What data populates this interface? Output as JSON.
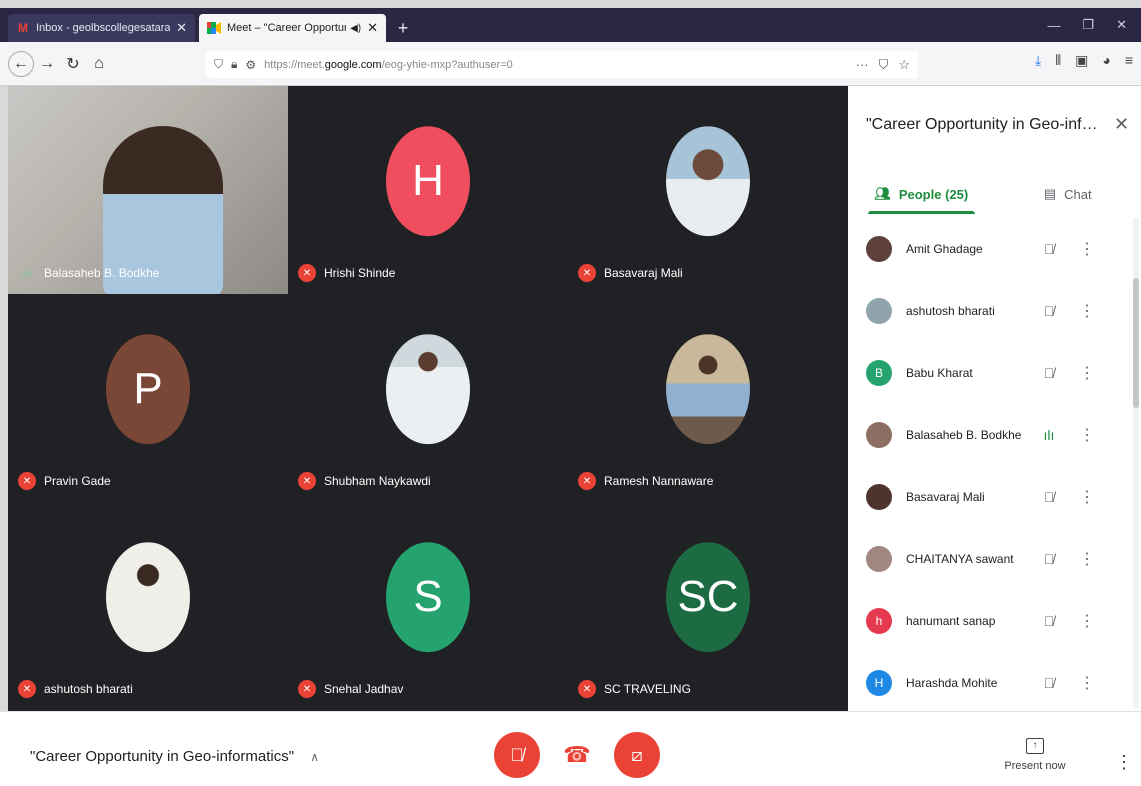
{
  "browser": {
    "tabs": [
      {
        "title": "Inbox - geolbscollegesatara@",
        "favicon": "M",
        "active": false
      },
      {
        "title": "Meet – \"Career Opportunit",
        "favicon": "meet",
        "active": true
      }
    ],
    "new_tab": "+",
    "url_prefix": "https://meet.",
    "url_domain": "google.com",
    "url_path": "/eog-yhie-mxp?authuser=0"
  },
  "grid": {
    "tiles": [
      {
        "name": "Balasaheb B. Bodkhe",
        "kind": "video",
        "mic": "on"
      },
      {
        "name": "Hrishi Shinde",
        "kind": "letter",
        "letter": "H",
        "color": "#f04e5e",
        "mic": "off"
      },
      {
        "name": "Basavaraj Mali",
        "kind": "photo",
        "mic": "off"
      },
      {
        "name": "Pravin Gade",
        "kind": "letter",
        "letter": "P",
        "color": "#7a4636",
        "mic": "off"
      },
      {
        "name": "Shubham Naykawdi",
        "kind": "photo",
        "mic": "off"
      },
      {
        "name": "Ramesh Nannaware",
        "kind": "photo",
        "mic": "off"
      },
      {
        "name": "ashutosh bharati",
        "kind": "photo",
        "mic": "off"
      },
      {
        "name": "Snehal Jadhav",
        "kind": "letter",
        "letter": "S",
        "color": "#25a36f",
        "mic": "off"
      },
      {
        "name": "SC TRAVELING",
        "kind": "letter",
        "letter": "SC",
        "color": "#1d6b43",
        "mic": "off"
      }
    ]
  },
  "panel": {
    "title": "\"Career Opportunity in Geo-infor...",
    "people_tab": "People (25)",
    "chat_tab": "Chat",
    "people": [
      {
        "name": "Amit Ghadage",
        "initial": "",
        "color": "#5d4037",
        "mic": "off"
      },
      {
        "name": "ashutosh bharati",
        "initial": "",
        "color": "#90a4ae",
        "mic": "off"
      },
      {
        "name": "Babu Kharat",
        "initial": "B",
        "color": "#25a36f",
        "mic": "off"
      },
      {
        "name": "Balasaheb B. Bodkhe",
        "initial": "",
        "color": "#8d6e63",
        "mic": "on"
      },
      {
        "name": "Basavaraj Mali",
        "initial": "",
        "color": "#4e342e",
        "mic": "off"
      },
      {
        "name": "CHAITANYA sawant",
        "initial": "",
        "color": "#a1887f",
        "mic": "off"
      },
      {
        "name": "hanumant sanap",
        "initial": "h",
        "color": "#e53950",
        "mic": "off"
      },
      {
        "name": "Harashda Mohite",
        "initial": "H",
        "color": "#1e88e5",
        "mic": "off"
      }
    ]
  },
  "bottom": {
    "meeting_name": "\"Career Opportunity in Geo-informatics\"",
    "present_label": "Present now"
  }
}
